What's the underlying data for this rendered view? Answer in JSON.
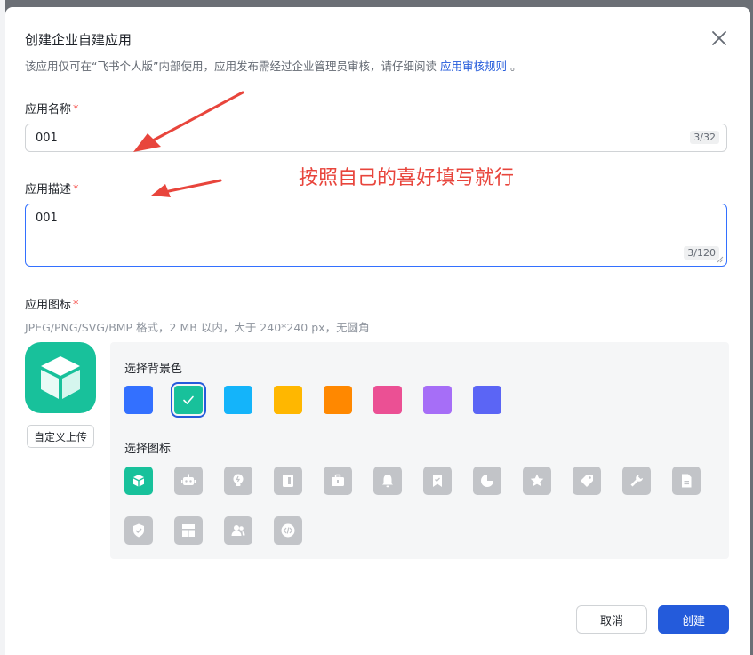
{
  "dialog": {
    "title": "创建企业自建应用",
    "subtitle": "该应用仅可在“飞书个人版”内部使用，应用发布需经过企业管理员审核，请仔细阅读",
    "subtitle_link": "应用审核规则",
    "subtitle_end": "。"
  },
  "name_field": {
    "label": "应用名称",
    "required_mark": "*",
    "value": "001",
    "counter": "3/32"
  },
  "desc_field": {
    "label": "应用描述",
    "required_mark": "*",
    "value": "001",
    "counter": "3/120"
  },
  "icon_field": {
    "label": "应用图标",
    "required_mark": "*",
    "hint": "JPEG/PNG/SVG/BMP 格式，2 MB 以内，大于 240*240 px，无圆角",
    "upload_label": "自定义上传",
    "bg_section_title": "选择背景色",
    "icon_section_title": "选择图标",
    "colors": [
      "#3370ff",
      "#18c19b",
      "#14b4fa",
      "#ffb700",
      "#ff8800",
      "#eb5094",
      "#a66ef7",
      "#5b65f5"
    ],
    "selected_color_index": 1,
    "icons": [
      "cube-icon",
      "robot-icon",
      "bulb-icon",
      "book-icon",
      "briefcase-icon",
      "bell-icon",
      "bookmark-icon",
      "pie-chart-icon",
      "star-icon",
      "tag-icon",
      "wrench-icon",
      "document-icon",
      "shield-icon",
      "layout-icon",
      "users-icon",
      "code-icon"
    ],
    "selected_icon_index": 0
  },
  "footer": {
    "cancel_label": "取消",
    "create_label": "创建"
  },
  "annotation": {
    "text": "按照自己的喜好填写就行",
    "color": "#e8453c"
  }
}
